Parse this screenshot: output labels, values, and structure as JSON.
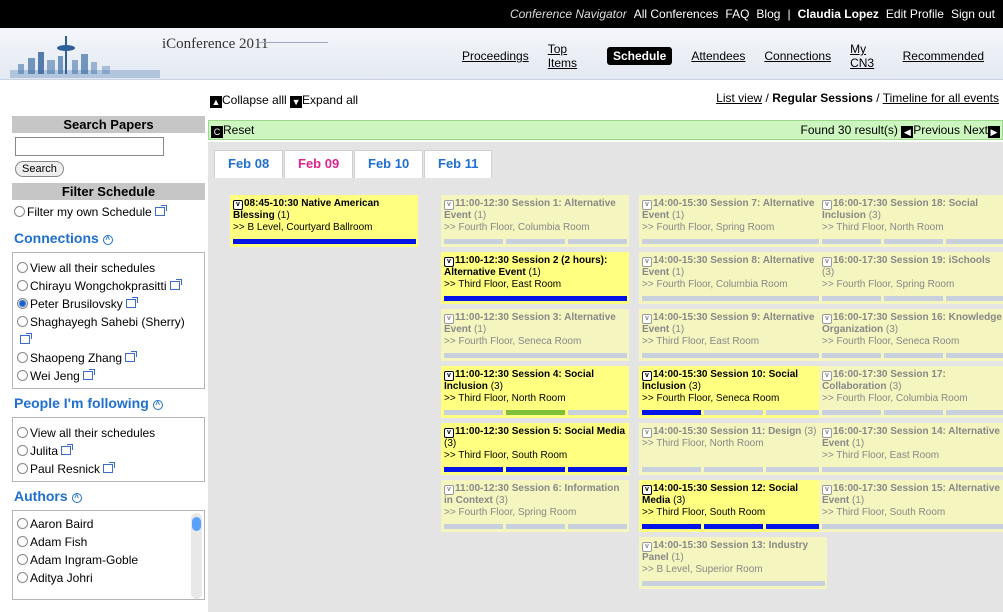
{
  "topbar": {
    "site": "Conference Navigator",
    "links": [
      "All Conferences",
      "FAQ",
      "Blog"
    ],
    "sep": "|",
    "user": "Claudia Lopez",
    "edit": "Edit Profile",
    "signout": "Sign out"
  },
  "header": {
    "title": "iConference 2011",
    "nav": [
      "Proceedings",
      "Top Items",
      "Schedule",
      "Attendees",
      "Connections",
      "My CN3",
      "Recommended"
    ],
    "active": "Schedule"
  },
  "controls": {
    "collapse": "Collapse alll",
    "expand": "Expand all",
    "list_view": "List view",
    "slash": "/",
    "regular": "Regular Sessions",
    "timeline": "Timeline for all events",
    "reset": "Reset",
    "found": "Found 30 result(s)",
    "previous": "Previous",
    "next": "Next"
  },
  "tabs": [
    "Feb 08",
    "Feb 09",
    "Feb 10",
    "Feb 11"
  ],
  "sidebar": {
    "search_title": "Search Papers",
    "search_value": "",
    "search_button": "Search",
    "filter_title": "Filter Schedule",
    "filter_own": "Filter my own Schedule",
    "connections_title": "Connections",
    "connections": [
      "View all their schedules",
      "Chirayu Wongchokprasitti",
      "Peter Brusilovsky",
      "Shaghayegh Sahebi (Sherry)",
      "Shaopeng Zhang",
      "Wei Jeng"
    ],
    "following_title": "People I'm following",
    "following": [
      "View all their schedules",
      "Julita",
      "Paul Resnick"
    ],
    "authors_title": "Authors",
    "authors": [
      "Aaron Baird",
      "Adam Fish",
      "Adam Ingram-Goble",
      "Aditya Johri"
    ]
  },
  "columns": [
    {
      "cards": [
        {
          "time": "08:45-10:30",
          "title": "Native American Blessing",
          "count": "(1)",
          "loc": ">> B Level, Courtyard Ballroom",
          "sel": true,
          "bars": [
            "blue"
          ]
        }
      ]
    },
    {
      "cards": [
        {
          "time": "11:00-12:30",
          "title": "Session 1: Alternative Event",
          "count": "(1)",
          "loc": ">> Fourth Floor, Columbia Room",
          "sel": false,
          "bars": [
            "g",
            "g",
            "g"
          ]
        },
        {
          "time": "11:00-12:30",
          "title": "Session 2 (2 hours): Alternative Event",
          "count": "(1)",
          "loc": ">> Third Floor, East Room",
          "sel": true,
          "bars": [
            "blue"
          ]
        },
        {
          "time": "11:00-12:30",
          "title": "Session 3: Alternative Event",
          "count": "(1)",
          "loc": ">> Fourth Floor, Seneca Room",
          "sel": false,
          "bars": [
            "g"
          ]
        },
        {
          "time": "11:00-12:30",
          "title": "Session 4: Social Inclusion",
          "count": "(3)",
          "loc": ">> Third Floor, North Room",
          "sel": true,
          "bars": [
            "g",
            "green",
            "g"
          ]
        },
        {
          "time": "11:00-12:30",
          "title": "Session 5: Social Media",
          "count": "(3)",
          "loc": ">> Third Floor, South Room",
          "sel": true,
          "bars": [
            "blue",
            "blue",
            "blue"
          ]
        },
        {
          "time": "11:00-12:30",
          "title": "Session 6: Information in Context",
          "count": "(3)",
          "loc": ">> Fourth Floor, Spring Room",
          "sel": false,
          "bars": [
            "g",
            "g",
            "g"
          ]
        }
      ]
    },
    {
      "cards": [
        {
          "time": "14:00-15:30",
          "title": "Session 7: Alternative Event",
          "count": "(1)",
          "loc": ">> Fourth Floor, Spring Room",
          "sel": false,
          "bars": [
            "g"
          ]
        },
        {
          "time": "14:00-15:30",
          "title": "Session 8: Alternative Event",
          "count": "(1)",
          "loc": ">> Fourth Floor, Columbia Room",
          "sel": false,
          "bars": [
            "g"
          ]
        },
        {
          "time": "14:00-15:30",
          "title": "Session 9: Alternative Event",
          "count": "(1)",
          "loc": ">> Third Floor, East Room",
          "sel": false,
          "bars": [
            "g"
          ]
        },
        {
          "time": "14:00-15:30",
          "title": "Session 10: Social Inclusion",
          "count": "(3)",
          "loc": ">> Fourth Floor, Seneca Room",
          "sel": true,
          "bars": [
            "blue",
            "g",
            "g"
          ]
        },
        {
          "time": "14:00-15:30",
          "title": "Session 11: Design",
          "count": "(3)",
          "loc": ">> Third Floor, North Room",
          "sel": false,
          "bars": [
            "g",
            "g",
            "g"
          ]
        },
        {
          "time": "14:00-15:30",
          "title": "Session 12: Social Media",
          "count": "(3)",
          "loc": ">> Third Floor, South Room",
          "sel": true,
          "bars": [
            "blue",
            "blue",
            "blue"
          ]
        },
        {
          "time": "14:00-15:30",
          "title": "Session 13: Industry Panel",
          "count": "(1)",
          "loc": ">> B Level, Superior Room",
          "sel": false,
          "bars": [
            "g"
          ]
        }
      ]
    },
    {
      "cards": [
        {
          "time": "16:00-17:30",
          "title": "Session 18: Social Inclusion",
          "count": "(3)",
          "loc": ">> Third Floor, North Room",
          "sel": false,
          "bars": [
            "g",
            "g",
            "g"
          ]
        },
        {
          "time": "16:00-17:30",
          "title": "Session 19: iSchools",
          "count": "(3)",
          "loc": ">> Fourth Floor, Spring Room",
          "sel": false,
          "bars": [
            "g",
            "g",
            "g"
          ]
        },
        {
          "time": "16:00-17:30",
          "title": "Session 16: Knowledge Organization",
          "count": "(3)",
          "loc": ">> Fourth Floor, Seneca Room",
          "sel": false,
          "bars": [
            "g",
            "g",
            "g"
          ]
        },
        {
          "time": "16:00-17:30",
          "title": "Session 17: Collaboration",
          "count": "(3)",
          "loc": ">> Fourth Floor, Columbia Room",
          "sel": false,
          "bars": [
            "g",
            "g",
            "g"
          ]
        },
        {
          "time": "16:00-17:30",
          "title": "Session 14: Alternative Event",
          "count": "(1)",
          "loc": ">> Third Floor, East Room",
          "sel": false,
          "bars": [
            "g"
          ]
        },
        {
          "time": "16:00-17:30",
          "title": "Session 15: Alternative Event",
          "count": "(1)",
          "loc": ">> Third Floor, South Room",
          "sel": false,
          "bars": [
            "g"
          ]
        }
      ]
    }
  ],
  "colors": {
    "accent": "#1f6fd1",
    "active_tab": "#e0248c",
    "selected_card": "#ffff80",
    "card": "#f5f5bf",
    "result_bar": "#ccf5bf",
    "blue_bar": "#0014e6"
  }
}
